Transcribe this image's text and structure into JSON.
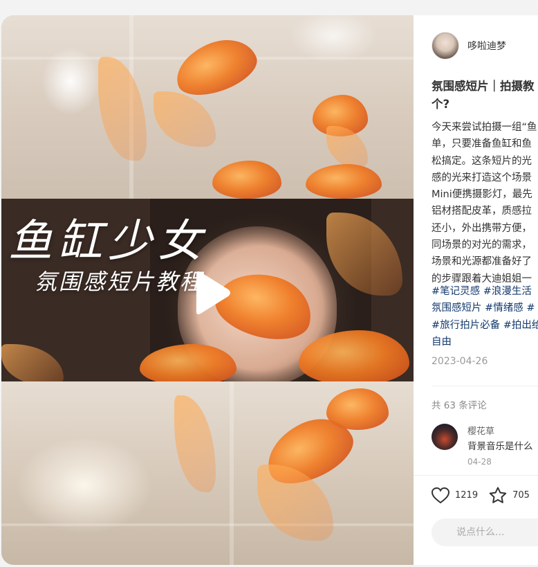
{
  "video": {
    "title_art": "鱼缸少女",
    "subtitle_art": "氛围感短片教程"
  },
  "author": {
    "name": "哆啦迪梦"
  },
  "note": {
    "title_lines": "氛围感短片｜拍摄教\n个?",
    "desc": "今天来尝试拍摄一组“鱼\n单，只要准备鱼缸和鱼\n松搞定。这条短片的光\n感的光来打造这个场景\nMini便携摄影灯，最先\n铝材搭配皮革，质感拉\n还小，外出携带方便，\n同场景的对光的需求，\n场景和光源都准备好了\n的步骤跟着大迪姐姐一",
    "tags_line1": "#笔记灵感 #浪漫生活",
    "tags_line2": "氛围感短片 #情绪感 #",
    "tags_line3": "#旅行拍片必备 #拍出给",
    "tags_line4": "自由",
    "date": "2023-04-26"
  },
  "comments": {
    "count_label": "共 63 条评论",
    "items": [
      {
        "user": "樱花草",
        "text": "背景音乐是什么",
        "date": "04-28"
      }
    ]
  },
  "actions": {
    "likes": "1219",
    "stars": "705"
  },
  "input": {
    "placeholder": "说点什么..."
  },
  "colors": {
    "tag": "#13386c",
    "accent_fish": "#f07a22"
  },
  "icons": [
    "play-icon",
    "heart-icon",
    "star-icon",
    "comment-icon",
    "pencil-icon"
  ]
}
